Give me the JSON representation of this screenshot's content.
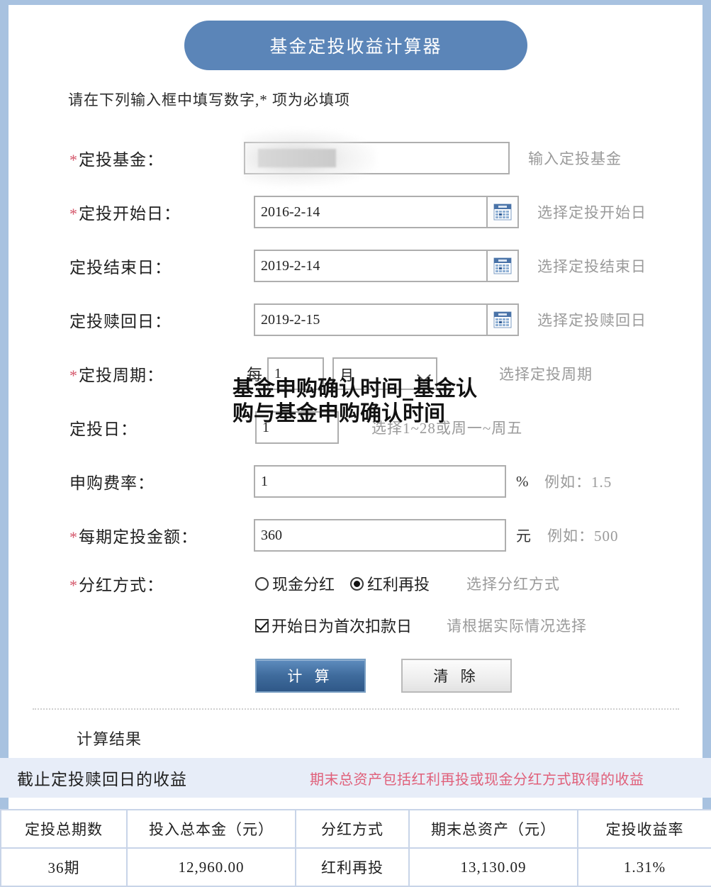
{
  "header": {
    "title": "基金定投收益计算器"
  },
  "intro": "请在下列输入框中填写数字,* 项为必填项",
  "form": {
    "rows": [
      {
        "label": "定投基金：",
        "required": true,
        "value": "",
        "hint": "输入定投基金"
      },
      {
        "label": "定投开始日：",
        "required": true,
        "value": "2016-2-14",
        "hint": "选择定投开始日",
        "icon": "calendar-icon"
      },
      {
        "label": "定投结束日：",
        "required": false,
        "value": "2019-2-14",
        "hint": "选择定投结束日",
        "icon": "calendar-icon"
      },
      {
        "label": "定投赎回日：",
        "required": false,
        "value": "2019-2-15",
        "hint": "选择定投赎回日",
        "icon": "calendar-icon"
      },
      {
        "label": "定投周期：",
        "required": true,
        "prefix": "每",
        "value": "1",
        "select_value": "月",
        "hint": "选择定投周期"
      },
      {
        "label": "定投日：",
        "required": false,
        "value": "1",
        "hint": "选择1~28或周一~周五"
      },
      {
        "label": "申购费率：",
        "required": false,
        "value": "1",
        "unit": "%",
        "hint": "例如：1.5"
      },
      {
        "label": "每期定投金额：",
        "required": true,
        "value": "360",
        "unit": "元",
        "hint": "例如：500"
      }
    ],
    "dividend": {
      "label": "分红方式：",
      "required": true,
      "option_cash": "现金分红",
      "option_reinvest": "红利再投",
      "selected": "红利再投",
      "hint": "选择分红方式",
      "checkbox_label": "开始日为首次扣款日",
      "checkbox_checked": true,
      "checkbox_hint": "请根据实际情况选择"
    },
    "buttons": {
      "calculate": "计 算",
      "clear": "清 除"
    }
  },
  "results": {
    "section_title": "计算结果",
    "band_left": "截止定投赎回日的收益",
    "band_note": "期末总资产包括红利再投或现金分红方式取得的收益",
    "table": {
      "headers": [
        "定投总期数",
        "投入总本金（元）",
        "分红方式",
        "期末总资产（元）",
        "定投收益率"
      ],
      "rows": [
        [
          "36期",
          "12,960.00",
          "红利再投",
          "13,130.09",
          "1.31%"
        ]
      ]
    }
  },
  "overlay": {
    "watermark_text": "基金申购确认时间_基金认购与基金申购确认时间"
  },
  "colors": {
    "page_border": "#a8c2e0",
    "title_bg": "#5b85b8",
    "band_bg": "#e7edf8",
    "accent_red": "#e0516f",
    "note_red": "#e0607a",
    "required_star": "#d4566a"
  }
}
